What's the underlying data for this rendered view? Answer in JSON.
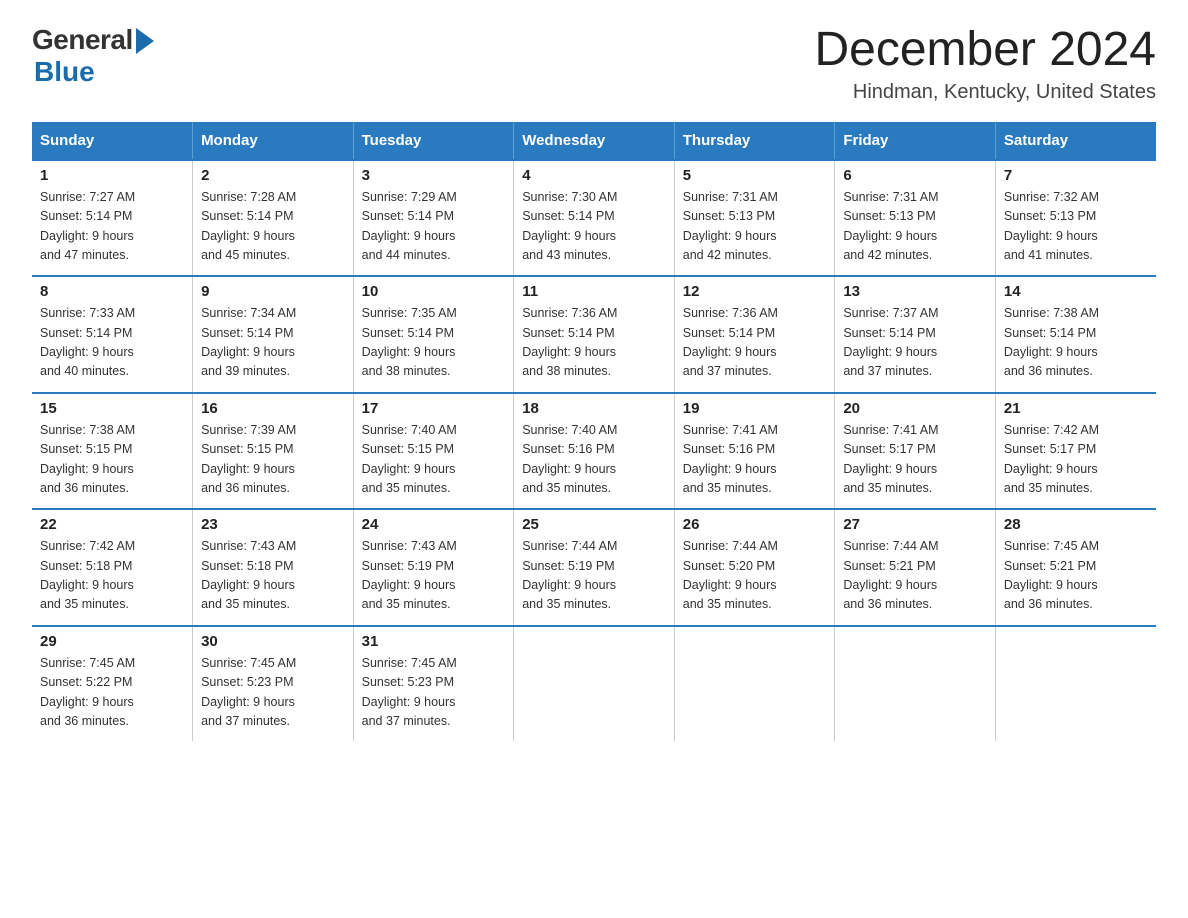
{
  "logo": {
    "general": "General",
    "blue": "Blue"
  },
  "title": {
    "month_year": "December 2024",
    "location": "Hindman, Kentucky, United States"
  },
  "days_of_week": [
    "Sunday",
    "Monday",
    "Tuesday",
    "Wednesday",
    "Thursday",
    "Friday",
    "Saturday"
  ],
  "weeks": [
    [
      {
        "day": "1",
        "sunrise": "7:27 AM",
        "sunset": "5:14 PM",
        "daylight": "9 hours and 47 minutes."
      },
      {
        "day": "2",
        "sunrise": "7:28 AM",
        "sunset": "5:14 PM",
        "daylight": "9 hours and 45 minutes."
      },
      {
        "day": "3",
        "sunrise": "7:29 AM",
        "sunset": "5:14 PM",
        "daylight": "9 hours and 44 minutes."
      },
      {
        "day": "4",
        "sunrise": "7:30 AM",
        "sunset": "5:14 PM",
        "daylight": "9 hours and 43 minutes."
      },
      {
        "day": "5",
        "sunrise": "7:31 AM",
        "sunset": "5:13 PM",
        "daylight": "9 hours and 42 minutes."
      },
      {
        "day": "6",
        "sunrise": "7:31 AM",
        "sunset": "5:13 PM",
        "daylight": "9 hours and 42 minutes."
      },
      {
        "day": "7",
        "sunrise": "7:32 AM",
        "sunset": "5:13 PM",
        "daylight": "9 hours and 41 minutes."
      }
    ],
    [
      {
        "day": "8",
        "sunrise": "7:33 AM",
        "sunset": "5:14 PM",
        "daylight": "9 hours and 40 minutes."
      },
      {
        "day": "9",
        "sunrise": "7:34 AM",
        "sunset": "5:14 PM",
        "daylight": "9 hours and 39 minutes."
      },
      {
        "day": "10",
        "sunrise": "7:35 AM",
        "sunset": "5:14 PM",
        "daylight": "9 hours and 38 minutes."
      },
      {
        "day": "11",
        "sunrise": "7:36 AM",
        "sunset": "5:14 PM",
        "daylight": "9 hours and 38 minutes."
      },
      {
        "day": "12",
        "sunrise": "7:36 AM",
        "sunset": "5:14 PM",
        "daylight": "9 hours and 37 minutes."
      },
      {
        "day": "13",
        "sunrise": "7:37 AM",
        "sunset": "5:14 PM",
        "daylight": "9 hours and 37 minutes."
      },
      {
        "day": "14",
        "sunrise": "7:38 AM",
        "sunset": "5:14 PM",
        "daylight": "9 hours and 36 minutes."
      }
    ],
    [
      {
        "day": "15",
        "sunrise": "7:38 AM",
        "sunset": "5:15 PM",
        "daylight": "9 hours and 36 minutes."
      },
      {
        "day": "16",
        "sunrise": "7:39 AM",
        "sunset": "5:15 PM",
        "daylight": "9 hours and 36 minutes."
      },
      {
        "day": "17",
        "sunrise": "7:40 AM",
        "sunset": "5:15 PM",
        "daylight": "9 hours and 35 minutes."
      },
      {
        "day": "18",
        "sunrise": "7:40 AM",
        "sunset": "5:16 PM",
        "daylight": "9 hours and 35 minutes."
      },
      {
        "day": "19",
        "sunrise": "7:41 AM",
        "sunset": "5:16 PM",
        "daylight": "9 hours and 35 minutes."
      },
      {
        "day": "20",
        "sunrise": "7:41 AM",
        "sunset": "5:17 PM",
        "daylight": "9 hours and 35 minutes."
      },
      {
        "day": "21",
        "sunrise": "7:42 AM",
        "sunset": "5:17 PM",
        "daylight": "9 hours and 35 minutes."
      }
    ],
    [
      {
        "day": "22",
        "sunrise": "7:42 AM",
        "sunset": "5:18 PM",
        "daylight": "9 hours and 35 minutes."
      },
      {
        "day": "23",
        "sunrise": "7:43 AM",
        "sunset": "5:18 PM",
        "daylight": "9 hours and 35 minutes."
      },
      {
        "day": "24",
        "sunrise": "7:43 AM",
        "sunset": "5:19 PM",
        "daylight": "9 hours and 35 minutes."
      },
      {
        "day": "25",
        "sunrise": "7:44 AM",
        "sunset": "5:19 PM",
        "daylight": "9 hours and 35 minutes."
      },
      {
        "day": "26",
        "sunrise": "7:44 AM",
        "sunset": "5:20 PM",
        "daylight": "9 hours and 35 minutes."
      },
      {
        "day": "27",
        "sunrise": "7:44 AM",
        "sunset": "5:21 PM",
        "daylight": "9 hours and 36 minutes."
      },
      {
        "day": "28",
        "sunrise": "7:45 AM",
        "sunset": "5:21 PM",
        "daylight": "9 hours and 36 minutes."
      }
    ],
    [
      {
        "day": "29",
        "sunrise": "7:45 AM",
        "sunset": "5:22 PM",
        "daylight": "9 hours and 36 minutes."
      },
      {
        "day": "30",
        "sunrise": "7:45 AM",
        "sunset": "5:23 PM",
        "daylight": "9 hours and 37 minutes."
      },
      {
        "day": "31",
        "sunrise": "7:45 AM",
        "sunset": "5:23 PM",
        "daylight": "9 hours and 37 minutes."
      },
      null,
      null,
      null,
      null
    ]
  ],
  "labels": {
    "sunrise": "Sunrise:",
    "sunset": "Sunset:",
    "daylight": "Daylight:"
  }
}
